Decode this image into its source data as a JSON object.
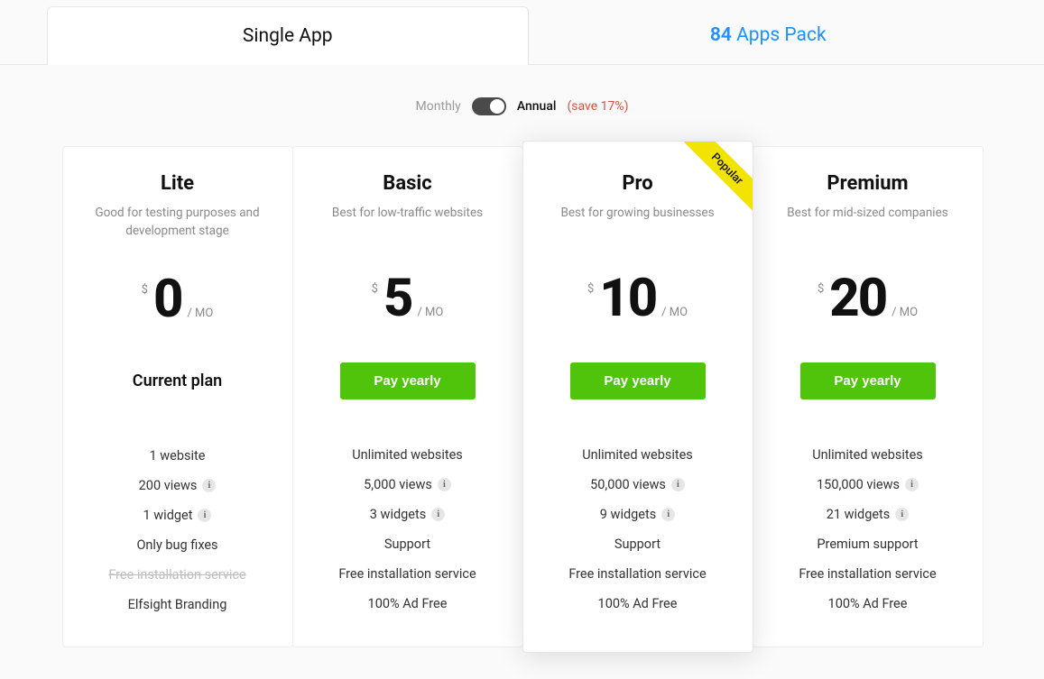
{
  "tabs": {
    "single": "Single App",
    "pack_count": "84",
    "pack_suffix": "Apps Pack"
  },
  "billing": {
    "monthly": "Monthly",
    "annual": "Annual",
    "save": "(save 17%)"
  },
  "plans": [
    {
      "name": "Lite",
      "subtitle": "Good for testing purposes and development stage",
      "currency": "$",
      "amount": "0",
      "period": "/ MO",
      "cta_type": "current",
      "cta_label": "Current plan",
      "popular": false,
      "features": [
        {
          "text": "1 website",
          "info": false,
          "struck": false
        },
        {
          "text": "200 views",
          "info": true,
          "struck": false
        },
        {
          "text": "1 widget",
          "info": true,
          "struck": false
        },
        {
          "text": "Only bug fixes",
          "info": false,
          "struck": false
        },
        {
          "text": "Free installation service",
          "info": false,
          "struck": true
        },
        {
          "text": "Elfsight Branding",
          "info": false,
          "struck": false
        }
      ]
    },
    {
      "name": "Basic",
      "subtitle": "Best for low-traffic websites",
      "currency": "$",
      "amount": "5",
      "period": "/ MO",
      "cta_type": "button",
      "cta_label": "Pay yearly",
      "popular": false,
      "features": [
        {
          "text": "Unlimited websites",
          "info": false,
          "struck": false
        },
        {
          "text": "5,000 views",
          "info": true,
          "struck": false
        },
        {
          "text": "3 widgets",
          "info": true,
          "struck": false
        },
        {
          "text": "Support",
          "info": false,
          "struck": false
        },
        {
          "text": "Free installation service",
          "info": false,
          "struck": false
        },
        {
          "text": "100% Ad Free",
          "info": false,
          "struck": false
        }
      ]
    },
    {
      "name": "Pro",
      "subtitle": "Best for growing businesses",
      "currency": "$",
      "amount": "10",
      "period": "/ MO",
      "cta_type": "button",
      "cta_label": "Pay yearly",
      "popular": true,
      "popular_label": "Popular",
      "features": [
        {
          "text": "Unlimited websites",
          "info": false,
          "struck": false
        },
        {
          "text": "50,000 views",
          "info": true,
          "struck": false
        },
        {
          "text": "9 widgets",
          "info": true,
          "struck": false
        },
        {
          "text": "Support",
          "info": false,
          "struck": false
        },
        {
          "text": "Free installation service",
          "info": false,
          "struck": false
        },
        {
          "text": "100% Ad Free",
          "info": false,
          "struck": false
        }
      ]
    },
    {
      "name": "Premium",
      "subtitle": "Best for mid-sized companies",
      "currency": "$",
      "amount": "20",
      "period": "/ MO",
      "cta_type": "button",
      "cta_label": "Pay yearly",
      "popular": false,
      "features": [
        {
          "text": "Unlimited websites",
          "info": false,
          "struck": false
        },
        {
          "text": "150,000 views",
          "info": true,
          "struck": false
        },
        {
          "text": "21 widgets",
          "info": true,
          "struck": false
        },
        {
          "text": "Premium support",
          "info": false,
          "struck": false
        },
        {
          "text": "Free installation service",
          "info": false,
          "struck": false
        },
        {
          "text": "100% Ad Free",
          "info": false,
          "struck": false
        }
      ]
    }
  ]
}
